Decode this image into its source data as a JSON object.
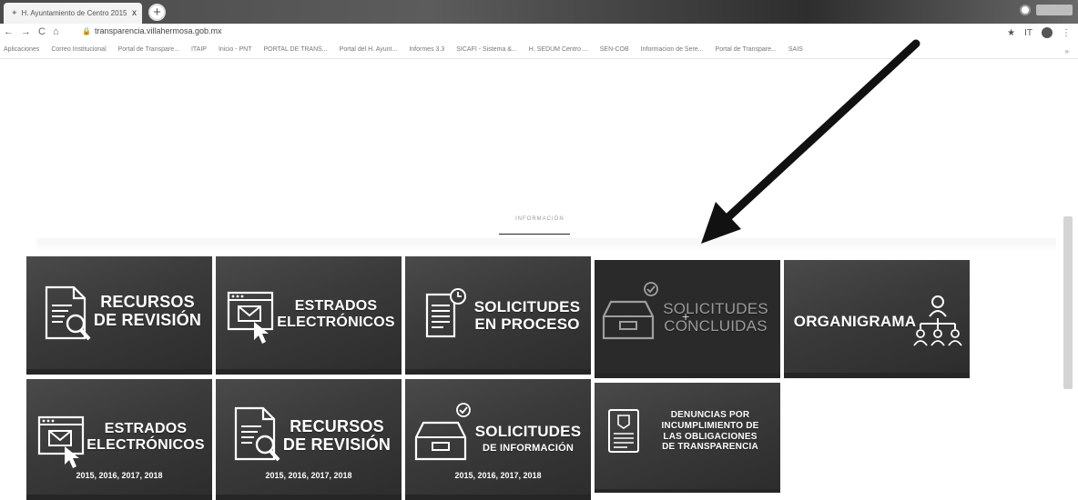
{
  "browser": {
    "tab_title": "H. Ayuntamiento de Centro 2015",
    "tab_close": "x",
    "new_tab": "+",
    "url": "transparencia.villahermosa.gob.mx",
    "nav_back": "←",
    "nav_forward": "→",
    "nav_reload": "C",
    "nav_home": "⌂",
    "star": "★",
    "extension": "IT",
    "menu": "⋮",
    "bookmarks_close": "»",
    "bookmarks": [
      "Aplicaciones",
      "Correo Institucional",
      "Portal de Transpare...",
      "ITAIP",
      "Inicio - PNT",
      "PORTAL DE TRANS...",
      "Portal del H. Ayunt...",
      "Informes 3.3",
      "SICAFI - Sistema &...",
      "H. SEDUM Centro ...",
      "SEN-COB",
      "Informacion de Sere...",
      "Portal de Transpare...",
      "SAIS"
    ]
  },
  "page": {
    "section_label": "INFORMACIÓN"
  },
  "tiles": [
    {
      "line1": "RECURSOS",
      "line2": "DE REVISIÓN"
    },
    {
      "line1": "ESTRADOS",
      "line2": "ELECTRÓNICOS"
    },
    {
      "line1": "SOLICITUDES",
      "line2": "EN PROCESO"
    },
    {
      "line1": "SOLICITUDES",
      "line2": "CONCLUIDAS"
    },
    {
      "line1": "ORGANIGRAMA"
    },
    {
      "line1": "ESTRADOS",
      "line2": "ELECTRÓNICOS",
      "years": "2015, 2016, 2017, 2018"
    },
    {
      "line1": "RECURSOS",
      "line2": "DE REVISIÓN",
      "years": "2015, 2016, 2017, 2018"
    },
    {
      "line1": "SOLICITUDES",
      "line2": "DE INFORMACIÓN",
      "years": "2015, 2016, 2017, 2018"
    },
    {
      "line1": "DENUNCIAS POR",
      "line2": "INCUMPLIMIENTO DE",
      "line3": "LAS OBLIGACIONES",
      "line4": "DE TRANSPARENCIA"
    }
  ],
  "colors": {
    "tile_bg": "#3a3a3a",
    "tile_text": "#ffffff",
    "annotation_arrow": "#111111"
  }
}
